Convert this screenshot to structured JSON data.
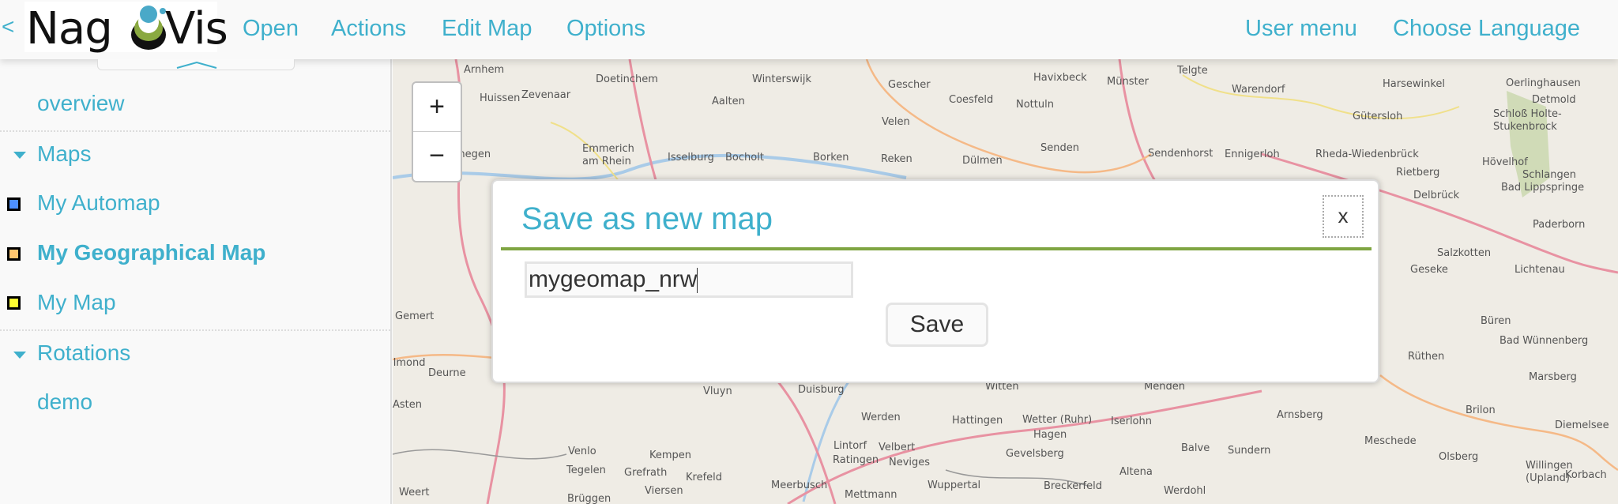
{
  "header": {
    "back": "<",
    "logo_text": "NagVis",
    "logo_left": "Nag",
    "logo_right": "Vis",
    "menu": {
      "open": "Open",
      "actions": "Actions",
      "edit_map": "Edit Map",
      "options": "Options",
      "user_menu": "User menu",
      "choose_language": "Choose Language"
    }
  },
  "sidebar": {
    "overview": "overview",
    "maps_header": "Maps",
    "maps": [
      {
        "label": "My Automap",
        "color": "#4d90ff"
      },
      {
        "label": "My Geographical Map",
        "color": "#ffc66e",
        "active": true
      },
      {
        "label": "My Map",
        "color": "#ffff33"
      }
    ],
    "rotations_header": "Rotations",
    "rotations": [
      {
        "label": "demo"
      }
    ]
  },
  "map": {
    "zoom_in": "+",
    "zoom_out": "−",
    "labels": [
      "Doetinchem",
      "Winterswijk",
      "Gescher",
      "Coesfeld",
      "Havixbeck",
      "Münster",
      "Telgte",
      "Warendorf",
      "Harsewinkel",
      "Oerlinghausen",
      "Detmold",
      "Huissen",
      "Zevenaar",
      "Aalten",
      "Velen",
      "Nottuln",
      "Gütersloh",
      "Schloß Holte-",
      "Stukenbrock",
      "Nijmegen",
      "Emmerich",
      "am Rhein",
      "Isselburg",
      "Bocholt",
      "Borken",
      "Reken",
      "Dülmen",
      "Senden",
      "Sendenhorst",
      "Enniger­loh",
      "Rheda-Wiedenbrück",
      "Rietberg",
      "Hövelhof",
      "Schlangen",
      "Bad Lippspringe",
      "Delbrück",
      "Paderborn",
      "Salzkotten",
      "Geseke",
      "Lichtenau",
      "Büren",
      "Bad Wünnenberg",
      "Rüthen",
      "Gemert",
      "Helmond",
      "Deurne",
      "Asten",
      "Venlo",
      "Tegelen",
      "Kempen",
      "Grefrath",
      "Krefeld",
      "Duisburg",
      "Vluyn",
      "Werden",
      "Hattingen",
      "Witten",
      "Wetter (Ruhr)",
      "Hagen",
      "Iserlohn",
      "Menden",
      "Arnsberg",
      "Meschede",
      "Brilon",
      "Marsberg",
      "Diemelsee",
      "Lintorf",
      "Velbert",
      "Ratingen",
      "Neviges",
      "Gevelsberg",
      "Balve",
      "Sundern",
      "Olsberg",
      "Meerbusch",
      "Mettmann",
      "Wuppertal",
      "Breckerfeld",
      "Altena",
      "Werdohl",
      "Willingen",
      "(Upland)",
      "Korbach",
      "Weert",
      "Brüggen",
      "Viersen",
      "Arnhem"
    ]
  },
  "dialog": {
    "title": "Save as new map",
    "close": "x",
    "input_value": "mygeomap_nrw",
    "save_label": "Save",
    "accent": "#7fa542"
  },
  "colors": {
    "link": "#3fb0cc",
    "map_bg": "#efece5"
  }
}
